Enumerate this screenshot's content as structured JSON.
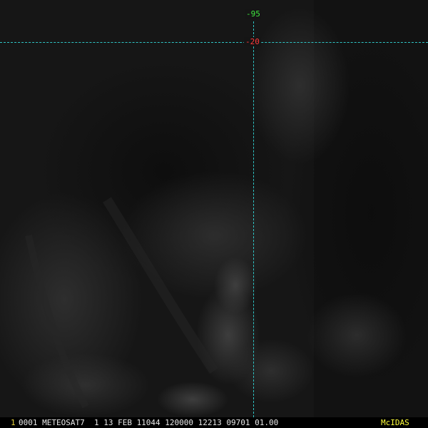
{
  "image": {
    "satellite": "METEOSAT7",
    "background": "#151515"
  },
  "grid": {
    "longitude_label": "-95",
    "latitude_label": "-20",
    "line_color": "#2fc6c6",
    "longitude_color": "#3ee63e",
    "latitude_color": "#ff3a3a"
  },
  "caption": {
    "frame_number": "1",
    "text": "0001 METEOSAT7  1 13 FEB 11044 120000 12213 09701 01.00",
    "brand": "McIDAS"
  }
}
